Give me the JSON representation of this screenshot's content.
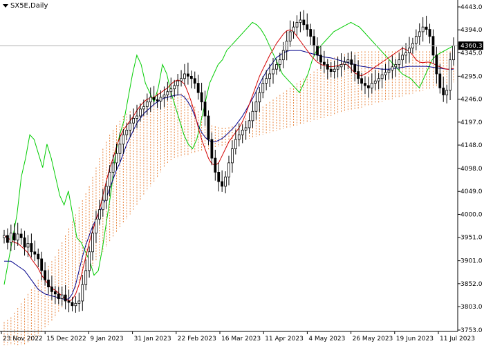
{
  "symbol": "SX5E,Daily",
  "price_label": "4360.3",
  "colors": {
    "background": "#ffffff",
    "tenkan": "#d40000",
    "kijun": "#00008b",
    "chikou": "#00cc00",
    "cloud": "#e8823a",
    "candle": "#000000",
    "price_line": "#b0b0b0"
  },
  "chart_data": {
    "type": "candlestick",
    "title": "",
    "ylim": [
      3753.0,
      4443.0
    ],
    "y_ticks": [
      "4443.0",
      "4394.0",
      "4345.0",
      "4295.0",
      "4246.0",
      "4197.0",
      "4148.0",
      "4098.0",
      "4049.0",
      "4000.0",
      "3951.0",
      "3901.0",
      "3852.0",
      "3803.0",
      "3753.0"
    ],
    "x_ticks": [
      "23 Nov 2022",
      "15 Dec 2022",
      "9 Jan 2023",
      "31 Jan 2023",
      "22 Feb 2023",
      "16 Mar 2023",
      "11 Apr 2023",
      "4 May 2023",
      "26 May 2023",
      "19 Jun 2023",
      "11 Jul 2023"
    ],
    "current_price": 4360.3,
    "close_series": [
      3955,
      3940,
      3960,
      3945,
      3958,
      3950,
      3930,
      3938,
      3920,
      3915,
      3905,
      3880,
      3860,
      3845,
      3835,
      3830,
      3820,
      3828,
      3815,
      3812,
      3805,
      3810,
      3815,
      3850,
      3880,
      3920,
      3960,
      3990,
      4010,
      4030,
      4060,
      4090,
      4110,
      4130,
      4150,
      4170,
      4180,
      4195,
      4205,
      4210,
      4225,
      4230,
      4240,
      4250,
      4245,
      4242,
      4250,
      4255,
      4262,
      4268,
      4275,
      4285,
      4290,
      4300,
      4295,
      4290,
      4280,
      4260,
      4240,
      4210,
      4160,
      4120,
      4090,
      4070,
      4060,
      4080,
      4110,
      4140,
      4160,
      4170,
      4180,
      4185,
      4200,
      4220,
      4240,
      4260,
      4280,
      4290,
      4300,
      4310,
      4320,
      4330,
      4350,
      4370,
      4390,
      4400,
      4410,
      4415,
      4405,
      4395,
      4380,
      4360,
      4340,
      4325,
      4320,
      4310,
      4305,
      4310,
      4315,
      4320,
      4325,
      4330,
      4320,
      4305,
      4290,
      4280,
      4275,
      4270,
      4280,
      4285,
      4290,
      4298,
      4303,
      4308,
      4315,
      4320,
      4330,
      4340,
      4345,
      4355,
      4365,
      4380,
      4390,
      4400,
      4395,
      4380,
      4340,
      4300,
      4270,
      4255,
      4265,
      4330,
      4360
    ],
    "tenkan_series": [
      3955,
      3950,
      3945,
      3940,
      3938,
      3932,
      3925,
      3918,
      3905,
      3895,
      3885,
      3870,
      3860,
      3850,
      3842,
      3838,
      3832,
      3826,
      3820,
      3815,
      3818,
      3830,
      3850,
      3880,
      3910,
      3940,
      3965,
      3990,
      4010,
      4040,
      4070,
      4100,
      4120,
      4145,
      4165,
      4180,
      4190,
      4200,
      4210,
      4222,
      4232,
      4240,
      4246,
      4248,
      4250,
      4255,
      4260,
      4265,
      4270,
      4278,
      4284,
      4287,
      4284,
      4278,
      4260,
      4240,
      4215,
      4185,
      4160,
      4140,
      4120,
      4108,
      4105,
      4110,
      4125,
      4140,
      4155,
      4165,
      4175,
      4185,
      4198,
      4215,
      4235,
      4255,
      4275,
      4295,
      4310,
      4325,
      4340,
      4352,
      4365,
      4375,
      4385,
      4392,
      4394,
      4390,
      4380,
      4370,
      4360,
      4350,
      4340,
      4332,
      4325,
      4320,
      4318,
      4316,
      4315,
      4316,
      4318,
      4320,
      4322,
      4318,
      4310,
      4302,
      4298,
      4296,
      4300,
      4304,
      4310,
      4315,
      4320,
      4325,
      4330,
      4335,
      4340,
      4345,
      4350,
      4355,
      4352,
      4348,
      4340,
      4330,
      4325,
      4324,
      4325,
      4325,
      4322,
      4318,
      4315,
      4312,
      4310,
      4310,
      4312
    ],
    "kijun_series": [
      3900,
      3900,
      3900,
      3895,
      3890,
      3885,
      3880,
      3870,
      3860,
      3850,
      3840,
      3835,
      3830,
      3828,
      3826,
      3824,
      3822,
      3820,
      3818,
      3820,
      3830,
      3850,
      3880,
      3910,
      3935,
      3955,
      3975,
      3990,
      4005,
      4020,
      4035,
      4055,
      4075,
      4095,
      4110,
      4130,
      4150,
      4165,
      4180,
      4195,
      4205,
      4215,
      4222,
      4228,
      4235,
      4240,
      4245,
      4248,
      4250,
      4252,
      4254,
      4255,
      4255,
      4250,
      4240,
      4228,
      4210,
      4190,
      4175,
      4165,
      4158,
      4155,
      4155,
      4158,
      4162,
      4168,
      4175,
      4182,
      4190,
      4200,
      4210,
      4222,
      4235,
      4248,
      4262,
      4278,
      4292,
      4305,
      4315,
      4325,
      4335,
      4340,
      4345,
      4348,
      4350,
      4350,
      4350,
      4350,
      4348,
      4346,
      4344,
      4342,
      4340,
      4338,
      4336,
      4335,
      4334,
      4332,
      4330,
      4328,
      4326,
      4324,
      4322,
      4320,
      4318,
      4316,
      4315,
      4314,
      4313,
      4312,
      4311,
      4310,
      4310,
      4310,
      4311,
      4312,
      4313,
      4314,
      4315,
      4316,
      4316,
      4316,
      4316,
      4316,
      4316,
      4315,
      4314,
      4313,
      4312,
      4311,
      4310,
      4310,
      4310
    ],
    "chikou_series": [
      3850,
      3900,
      3950,
      4000,
      4080,
      4120,
      4170,
      4160,
      4130,
      4100,
      4150,
      4120,
      4080,
      4040,
      4020,
      4050,
      4000,
      3950,
      3940,
      3920,
      3900,
      3870,
      3880,
      3930,
      3990,
      4050,
      4130,
      4170,
      4200,
      4250,
      4300,
      4340,
      4320,
      4280,
      4260,
      4240,
      4270,
      4320,
      4300,
      4260,
      4230,
      4200,
      4170,
      4150,
      4140,
      4160,
      4200,
      4240,
      4280,
      4300,
      4320,
      4330,
      4350,
      4360,
      4370,
      4380,
      4390,
      4400,
      4410,
      4405,
      4395,
      4380,
      4360,
      4340,
      4320,
      4300,
      4290,
      4280,
      4270,
      4260,
      4280,
      4300,
      4330,
      4350,
      4360,
      4370,
      4380,
      4390,
      4395,
      4400,
      4405,
      4410,
      4405,
      4400,
      4390,
      4380,
      4370,
      4360,
      4350,
      4340,
      4330,
      4320,
      4310,
      4300,
      4295,
      4290,
      4280,
      4270,
      4290,
      4310,
      4330,
      4340,
      4345,
      4350,
      4355,
      4360
    ],
    "cloud_top": [
      3770,
      3775,
      3780,
      3790,
      3800,
      3810,
      3820,
      3830,
      3840,
      3850,
      3860,
      3870,
      3880,
      3890,
      3900,
      3910,
      3925,
      3940,
      3955,
      3970,
      3985,
      4000,
      4015,
      4030,
      4045,
      4060,
      4080,
      4100,
      4120,
      4140,
      4155,
      4170,
      4180,
      4190,
      4200,
      4210,
      4215,
      4220,
      4225,
      4230,
      4235,
      4240,
      4245,
      4250,
      4255,
      4260,
      4262,
      4264,
      4266,
      4266,
      4265,
      4262,
      4258,
      4254,
      4248,
      4240,
      4230,
      4220,
      4210,
      4200,
      4195,
      4190,
      4188,
      4186,
      4185,
      4185,
      4186,
      4188,
      4190,
      4195,
      4200,
      4205,
      4210,
      4215,
      4220,
      4225,
      4230,
      4235,
      4240,
      4245,
      4250,
      4255,
      4260,
      4265,
      4270,
      4275,
      4280,
      4285,
      4290,
      4295,
      4300,
      4305,
      4310,
      4315,
      4320,
      4325,
      4330,
      4335,
      4338,
      4340,
      4342,
      4344,
      4345,
      4346,
      4347,
      4348,
      4348,
      4348,
      4348,
      4348,
      4348,
      4348,
      4348,
      4348,
      4348,
      4348,
      4348,
      4348,
      4348,
      4348,
      4348,
      4348,
      4348,
      4348,
      4348,
      4348,
      4348,
      4348,
      4348,
      4348,
      4348,
      4348,
      4348
    ],
    "cloud_bottom": [
      3700,
      3702,
      3705,
      3708,
      3712,
      3716,
      3720,
      3725,
      3730,
      3735,
      3740,
      3748,
      3756,
      3764,
      3772,
      3780,
      3790,
      3800,
      3810,
      3820,
      3830,
      3840,
      3850,
      3860,
      3870,
      3880,
      3890,
      3900,
      3910,
      3920,
      3930,
      3940,
      3950,
      3960,
      3970,
      3980,
      3990,
      4000,
      4010,
      4020,
      4030,
      4040,
      4050,
      4060,
      4070,
      4080,
      4090,
      4100,
      4108,
      4114,
      4118,
      4120,
      4122,
      4124,
      4126,
      4128,
      4130,
      4132,
      4134,
      4136,
      4138,
      4140,
      4142,
      4144,
      4146,
      4148,
      4150,
      4152,
      4154,
      4156,
      4158,
      4160,
      4162,
      4164,
      4166,
      4168,
      4170,
      4172,
      4174,
      4176,
      4178,
      4180,
      4182,
      4184,
      4186,
      4188,
      4190,
      4192,
      4194,
      4196,
      4198,
      4200,
      4202,
      4204,
      4206,
      4208,
      4210,
      4212,
      4214,
      4216,
      4218,
      4220,
      4222,
      4224,
      4226,
      4228,
      4230,
      4232,
      4234,
      4236,
      4238,
      4240,
      4242,
      4244,
      4246,
      4248,
      4250,
      4252,
      4254,
      4256,
      4258,
      4260,
      4262,
      4264,
      4266,
      4268,
      4270,
      4272,
      4274,
      4276,
      4278,
      4280,
      4282
    ]
  }
}
